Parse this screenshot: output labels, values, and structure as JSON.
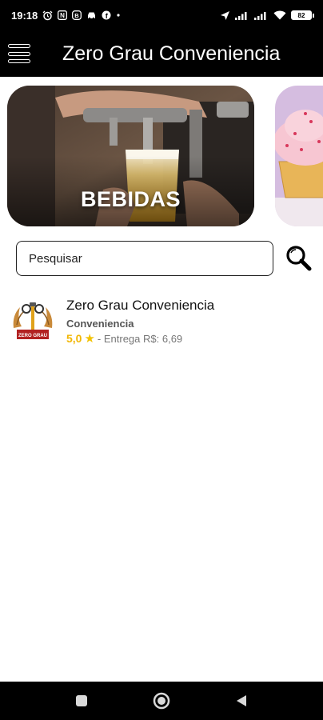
{
  "status_bar": {
    "time": "19:18",
    "battery": "82",
    "left_icons": [
      "alarm-icon",
      "nfc-icon",
      "app-icon",
      "car-icon",
      "facebook-icon",
      "dot-icon"
    ],
    "right_icons": [
      "location-icon",
      "signal-icon",
      "signal-icon",
      "wifi-icon",
      "battery-icon"
    ]
  },
  "app_bar": {
    "title": "Zero Grau Conveniencia",
    "menu_icon": "hamburger-menu-icon",
    "background": "#000000"
  },
  "categories": [
    {
      "label": "BEBIDAS",
      "image": "beer-tap-photo"
    },
    {
      "label": "",
      "image": "cupcake-photo"
    }
  ],
  "search": {
    "placeholder": "Pesquisar",
    "value": "",
    "icon": "magnifier-icon"
  },
  "stores": [
    {
      "name": "Zero Grau Conveniencia",
      "category": "Conveniencia",
      "rating": "5,0",
      "delivery": "- Entrega R$: 6,69",
      "logo": "zero-grau-logo"
    }
  ],
  "colors": {
    "rating": "#f2b705",
    "star": "#f2c200",
    "bars": "#000000"
  },
  "nav_bar": {
    "buttons": [
      "recent-apps-icon",
      "home-icon",
      "back-icon"
    ]
  }
}
